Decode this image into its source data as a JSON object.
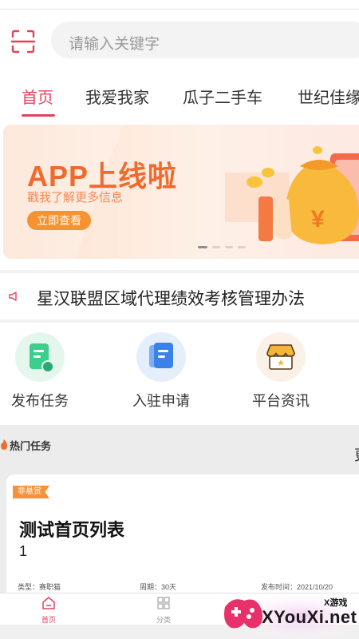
{
  "search": {
    "placeholder": "请输入关键字"
  },
  "tabs": [
    {
      "label": "首页",
      "active": true
    },
    {
      "label": "我爱我家",
      "active": false
    },
    {
      "label": "瓜子二手车",
      "active": false
    },
    {
      "label": "世纪佳缘",
      "active": false
    }
  ],
  "banner": {
    "title": "APP上线啦",
    "subtitle": "戳我了解更多信息",
    "button": "立即查看",
    "slide_count": 4,
    "active_slide": 1
  },
  "notice": {
    "text": "星汉联盟区域代理绩效考核管理办法"
  },
  "grid": [
    {
      "label": "发布任务",
      "icon": "publish-task-icon"
    },
    {
      "label": "入驻申请",
      "icon": "apply-join-icon"
    },
    {
      "label": "平台资讯",
      "icon": "platform-news-icon"
    }
  ],
  "hot": {
    "title": "热门任务",
    "more": "更",
    "card": {
      "tag": "非悬赏",
      "title": "测试首页列表",
      "number": "1",
      "type": "类型：赛职猫",
      "period": "周期：30天",
      "date": "发布时间：2021/10/20"
    }
  },
  "bottom_nav": [
    {
      "label": "首页",
      "icon": "home-icon",
      "active": true
    },
    {
      "label": "分类",
      "icon": "category-icon",
      "active": false
    }
  ],
  "watermark": {
    "small": "X游戏",
    "big": "XYouXi.net"
  },
  "colors": {
    "accent": "#e0445d",
    "orange": "#f06a2e",
    "tag": "#f7923a"
  }
}
